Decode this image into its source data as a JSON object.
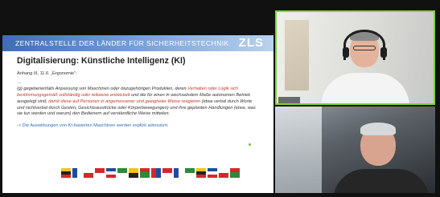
{
  "slide": {
    "header_text": "ZENTRALSTELLE DER LÄNDER FÜR SICHERHEITSTECHNIK",
    "logo_text": "ZLS",
    "title": "Digitalisierung: Künstliche Intelligenz (KI)",
    "reference": "Anhang III, 11.6. „Ergonomie“:",
    "ellipsis": "…",
    "quote_1": "(g) gegebenenfalls Anpassung von Maschinen oder dazugehörigen Produkten, deren ",
    "quote_red_1": "Verhalten oder Logik sich bestimmungsgemäß vollständig oder teilweise entwickelt",
    "quote_2": " und die für einen in wechselndem Maße autonomen Betrieb ausgelegt sind, ",
    "quote_red_2": "damit diese auf Personen in angemessener und geeigneter Weise reagieren",
    "quote_3": " (etwa verbal durch Worte und nichtverbal durch Gesten, Gesichtsausdrücke oder Körperbewegungen) und ihre geplanten Handlungen (etwa, was sie tun werden und warum) den Bedienern auf verständliche Weise mitteilen.",
    "note": "-> Die Auswirkungen von KI-basierten Maschinen werden explizit adressiert."
  },
  "colors": {
    "header_start": "#3f6db6",
    "header_end": "#b9d2ee",
    "highlight_red": "#c0392b",
    "note_blue": "#2f6db4",
    "active_speaker_border": "#7fd33b"
  },
  "participants": [
    {
      "role": "active-speaker",
      "icon": "headset-icon"
    },
    {
      "role": "participant"
    }
  ]
}
